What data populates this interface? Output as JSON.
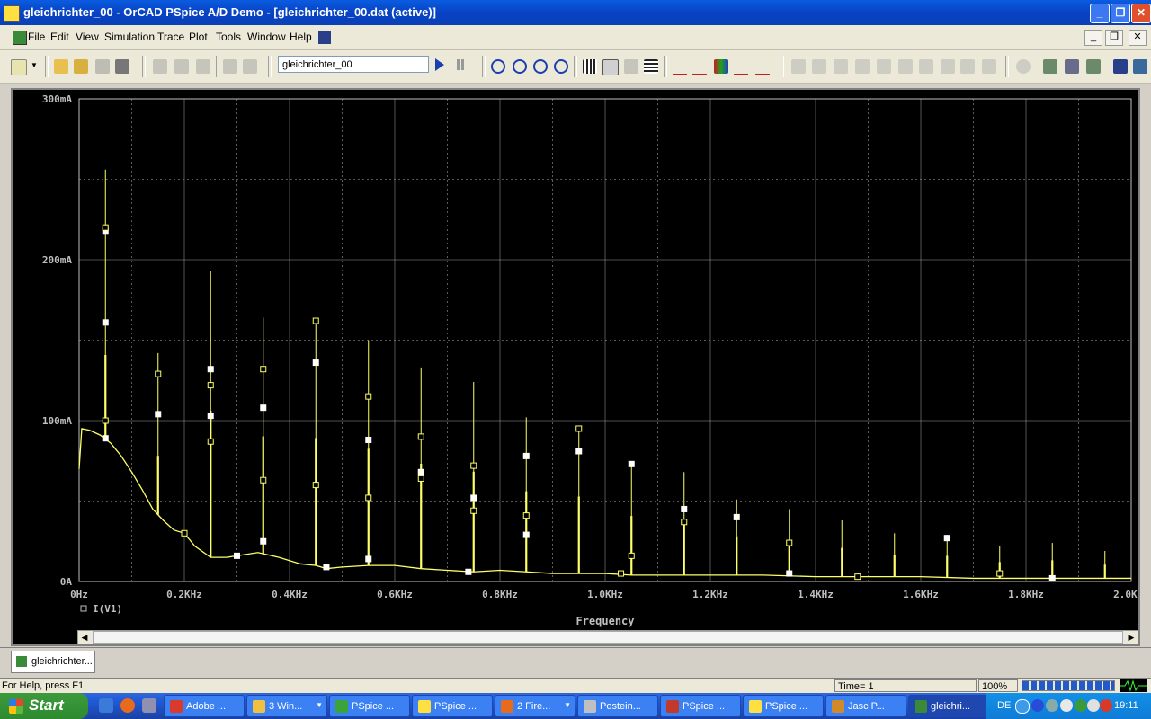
{
  "window": {
    "title": "gleichrichter_00 - OrCAD PSpice A/D Demo  - [gleichrichter_00.dat (active)]"
  },
  "menu": {
    "items": [
      "File",
      "Edit",
      "View",
      "Simulation",
      "Trace",
      "Plot",
      "Tools",
      "Window",
      "Help"
    ]
  },
  "toolbar": {
    "profile_value": "gleichrichter_00",
    "icons": [
      "new-icon",
      "open-icon",
      "open-folder-icon",
      "save-icon",
      "print-icon",
      "cut-icon",
      "copy-icon",
      "paste-icon",
      "undo-icon",
      "redo-icon",
      "run-icon",
      "pause-icon",
      "zoom-in-icon",
      "zoom-out-icon",
      "zoom-area-icon",
      "zoom-fit-icon",
      "axis-settings-icon",
      "fft-icon",
      "performance-icon",
      "table-icon",
      "add-trace-icon",
      "eval-measurement-icon",
      "plot-icon",
      "marker-icon",
      "cursor-icon"
    ]
  },
  "chart_data": {
    "type": "line",
    "xlabel": "Frequency",
    "ylabel": "",
    "xlim": [
      0,
      2000
    ],
    "ylim": [
      0,
      300
    ],
    "x_tick_labels": [
      "0Hz",
      "0.2KHz",
      "0.4KHz",
      "0.6KHz",
      "0.8KHz",
      "1.0KHz",
      "1.2KHz",
      "1.4KHz",
      "1.6KHz",
      "1.8KHz",
      "2.0KHz"
    ],
    "y_tick_labels": [
      "0A",
      "100mA",
      "200mA",
      "300mA"
    ],
    "grid": true,
    "legend": "bottom-left",
    "colors": {
      "trace": "#ffff66",
      "background": "#000000",
      "grid": "#bfbfbf",
      "axis_text": "#bfbfbf",
      "marker": "#ffffff"
    },
    "series": [
      {
        "name": "I(V1)",
        "baseline": [
          [
            0,
            70
          ],
          [
            5,
            95
          ],
          [
            20,
            94
          ],
          [
            40,
            91
          ],
          [
            60,
            86
          ],
          [
            80,
            78
          ],
          [
            100,
            68
          ],
          [
            120,
            57
          ],
          [
            140,
            45
          ],
          [
            160,
            38
          ],
          [
            180,
            32
          ],
          [
            200,
            30
          ],
          [
            220,
            22
          ],
          [
            250,
            15
          ],
          [
            280,
            15
          ],
          [
            300,
            16
          ],
          [
            340,
            18
          ],
          [
            380,
            15
          ],
          [
            420,
            11
          ],
          [
            450,
            10
          ],
          [
            470,
            8
          ],
          [
            500,
            9
          ],
          [
            550,
            10
          ],
          [
            600,
            10
          ],
          [
            650,
            8
          ],
          [
            700,
            7
          ],
          [
            750,
            6
          ],
          [
            800,
            7
          ],
          [
            850,
            6
          ],
          [
            900,
            5
          ],
          [
            950,
            5
          ],
          [
            1000,
            5
          ],
          [
            1050,
            4
          ],
          [
            1100,
            4
          ],
          [
            1200,
            4
          ],
          [
            1300,
            4
          ],
          [
            1400,
            3
          ],
          [
            1500,
            3
          ],
          [
            1600,
            3
          ],
          [
            1700,
            2
          ],
          [
            1800,
            2
          ],
          [
            1900,
            2
          ],
          [
            2000,
            2
          ]
        ],
        "harmonics": [
          {
            "f": 50,
            "peak": 256
          },
          {
            "f": 150,
            "peak": 142
          },
          {
            "f": 250,
            "peak": 193
          },
          {
            "f": 350,
            "peak": 164
          },
          {
            "f": 450,
            "peak": 162
          },
          {
            "f": 550,
            "peak": 150
          },
          {
            "f": 650,
            "peak": 133
          },
          {
            "f": 750,
            "peak": 124
          },
          {
            "f": 850,
            "peak": 102
          },
          {
            "f": 950,
            "peak": 96
          },
          {
            "f": 1050,
            "peak": 74
          },
          {
            "f": 1150,
            "peak": 68
          },
          {
            "f": 1250,
            "peak": 51
          },
          {
            "f": 1350,
            "peak": 45
          },
          {
            "f": 1450,
            "peak": 38
          },
          {
            "f": 1550,
            "peak": 30
          },
          {
            "f": 1650,
            "peak": 29
          },
          {
            "f": 1750,
            "peak": 22
          },
          {
            "f": 1850,
            "peak": 24
          },
          {
            "f": 1950,
            "peak": 19
          }
        ],
        "markers": [
          [
            50,
            218
          ],
          [
            50,
            220
          ],
          [
            50,
            161
          ],
          [
            50,
            100
          ],
          [
            50,
            89
          ],
          [
            150,
            129
          ],
          [
            150,
            104
          ],
          [
            200,
            30
          ],
          [
            250,
            132
          ],
          [
            250,
            122
          ],
          [
            250,
            103
          ],
          [
            250,
            87
          ],
          [
            300,
            16
          ],
          [
            350,
            132
          ],
          [
            350,
            108
          ],
          [
            350,
            63
          ],
          [
            350,
            25
          ],
          [
            450,
            162
          ],
          [
            450,
            136
          ],
          [
            450,
            60
          ],
          [
            470,
            9
          ],
          [
            550,
            115
          ],
          [
            550,
            88
          ],
          [
            550,
            52
          ],
          [
            550,
            14
          ],
          [
            650,
            90
          ],
          [
            650,
            68
          ],
          [
            650,
            64
          ],
          [
            740,
            6
          ],
          [
            750,
            72
          ],
          [
            750,
            52
          ],
          [
            750,
            44
          ],
          [
            850,
            78
          ],
          [
            850,
            41
          ],
          [
            850,
            29
          ],
          [
            950,
            95
          ],
          [
            950,
            81
          ],
          [
            1030,
            5
          ],
          [
            1050,
            73
          ],
          [
            1050,
            16
          ],
          [
            1150,
            45
          ],
          [
            1150,
            37
          ],
          [
            1250,
            40
          ],
          [
            1350,
            24
          ],
          [
            1350,
            5
          ],
          [
            1480,
            3
          ],
          [
            1650,
            27
          ],
          [
            1750,
            5
          ],
          [
            1850,
            2
          ]
        ]
      }
    ]
  },
  "tabs": [
    {
      "label": "gleichrichter..."
    }
  ],
  "status": {
    "help": "For Help, press F1",
    "time": "Time= 1",
    "zoom": "100%"
  },
  "taskbar": {
    "start": "Start",
    "tasks": [
      {
        "label": "Adobe ...",
        "icon": "adobe-icon",
        "color": "#d93a2b"
      },
      {
        "label": "3 Win...",
        "icon": "folder-icon",
        "color": "#f0c040",
        "group": true
      },
      {
        "label": "PSpice ...",
        "icon": "pspice-icon",
        "color": "#3aa33a"
      },
      {
        "label": "PSpice ...",
        "icon": "pspice-icon",
        "color": "#ffe040"
      },
      {
        "label": "2 Fire...",
        "icon": "firefox-icon",
        "color": "#e86a1c",
        "group": true
      },
      {
        "label": "Postein...",
        "icon": "mail-icon",
        "color": "#c0c0c0"
      },
      {
        "label": "PSpice ...",
        "icon": "pspice-icon",
        "color": "#c0392b"
      },
      {
        "label": "PSpice ...",
        "icon": "pspice-icon",
        "color": "#ffe040"
      },
      {
        "label": "Jasc P...",
        "icon": "jasc-icon",
        "color": "#d08a2a"
      },
      {
        "label": "gleichri...",
        "icon": "pspice-icon",
        "color": "#3a8a3a",
        "active": true
      }
    ],
    "tray": {
      "lang": "DE",
      "clock": "19:11"
    }
  }
}
